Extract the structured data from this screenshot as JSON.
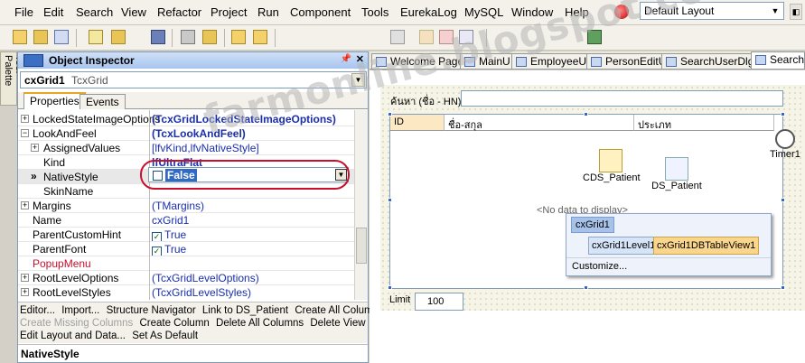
{
  "menu": [
    "File",
    "Edit",
    "Search",
    "View",
    "Refactor",
    "Project",
    "Run",
    "Component",
    "Tools",
    "EurekaLog",
    "MySQL",
    "Window",
    "Help"
  ],
  "layout_select": "Default Layout",
  "tool_palette": "Tool Palette",
  "inspector": {
    "title": "Object Inspector",
    "component_name": "cxGrid1",
    "component_type": "TcxGrid",
    "tabs": [
      "Properties",
      "Events"
    ],
    "properties": [
      {
        "name": "LockedStateImageOptions",
        "value": "(TcxGridLockedStateImageOptions)",
        "expand": "+",
        "bold": true
      },
      {
        "name": "LookAndFeel",
        "value": "(TcxLookAndFeel)",
        "expand": "-",
        "bold": true
      },
      {
        "name": "AssignedValues",
        "value": "[lfvKind,lfvNativeStyle]",
        "expand": "+",
        "indent": true
      },
      {
        "name": "Kind",
        "value": "lfUltraFlat",
        "indent": true,
        "bold": true
      },
      {
        "name": "NativeStyle",
        "value": "",
        "indent": true,
        "selected": true
      },
      {
        "name": "SkinName",
        "value": "",
        "indent": true
      },
      {
        "name": "Margins",
        "value": "(TMargins)",
        "expand": "+"
      },
      {
        "name": "Name",
        "value": "cxGrid1"
      },
      {
        "name": "ParentCustomHint",
        "value": "True",
        "check": true
      },
      {
        "name": "ParentFont",
        "value": "True",
        "check": true
      },
      {
        "name": "PopupMenu",
        "value": "",
        "red": true
      },
      {
        "name": "RootLevelOptions",
        "value": "(TcxGridLevelOptions)",
        "expand": "+"
      },
      {
        "name": "RootLevelStyles",
        "value": "(TcxGridLevelStyles)",
        "expand": "+"
      }
    ],
    "value_editor": "False",
    "verbs_line1": [
      "Editor...",
      "Import...",
      "Structure Navigator",
      "Link to DS_Patient",
      "Create All Columns"
    ],
    "verbs_line2_disabled": "Create Missing Columns",
    "verbs_line2": [
      "Create Column",
      "Delete All Columns",
      "Delete View"
    ],
    "verbs_line3": [
      "Edit Layout and Data...",
      "Set As Default"
    ],
    "status": "NativeStyle"
  },
  "editor_tabs": [
    "Welcome Page",
    "MainU",
    "EmployeeU",
    "PersonEditU",
    "SearchUserDlg",
    "SearchP"
  ],
  "form": {
    "search_label": "ค้นหา (ชื่อ - HN)",
    "columns": [
      "ID",
      "ชื่อ-สกุล",
      "ประเภท"
    ],
    "no_data": "<No data to display>",
    "components": [
      "CDS_Patient",
      "DS_Patient"
    ],
    "timer": "Timer1",
    "popup": {
      "root": "cxGrid1",
      "level": "cxGrid1Level1",
      "view": "cxGrid1DBTableView1",
      "customize": "Customize..."
    },
    "limit_label": "Limit",
    "limit_value": "100"
  },
  "watermark": "farmonline.blogspot.com",
  "colors": {
    "accent_red": "#c8102e",
    "selection": "#316ac5",
    "inspector_title": "#a8c4ee"
  }
}
